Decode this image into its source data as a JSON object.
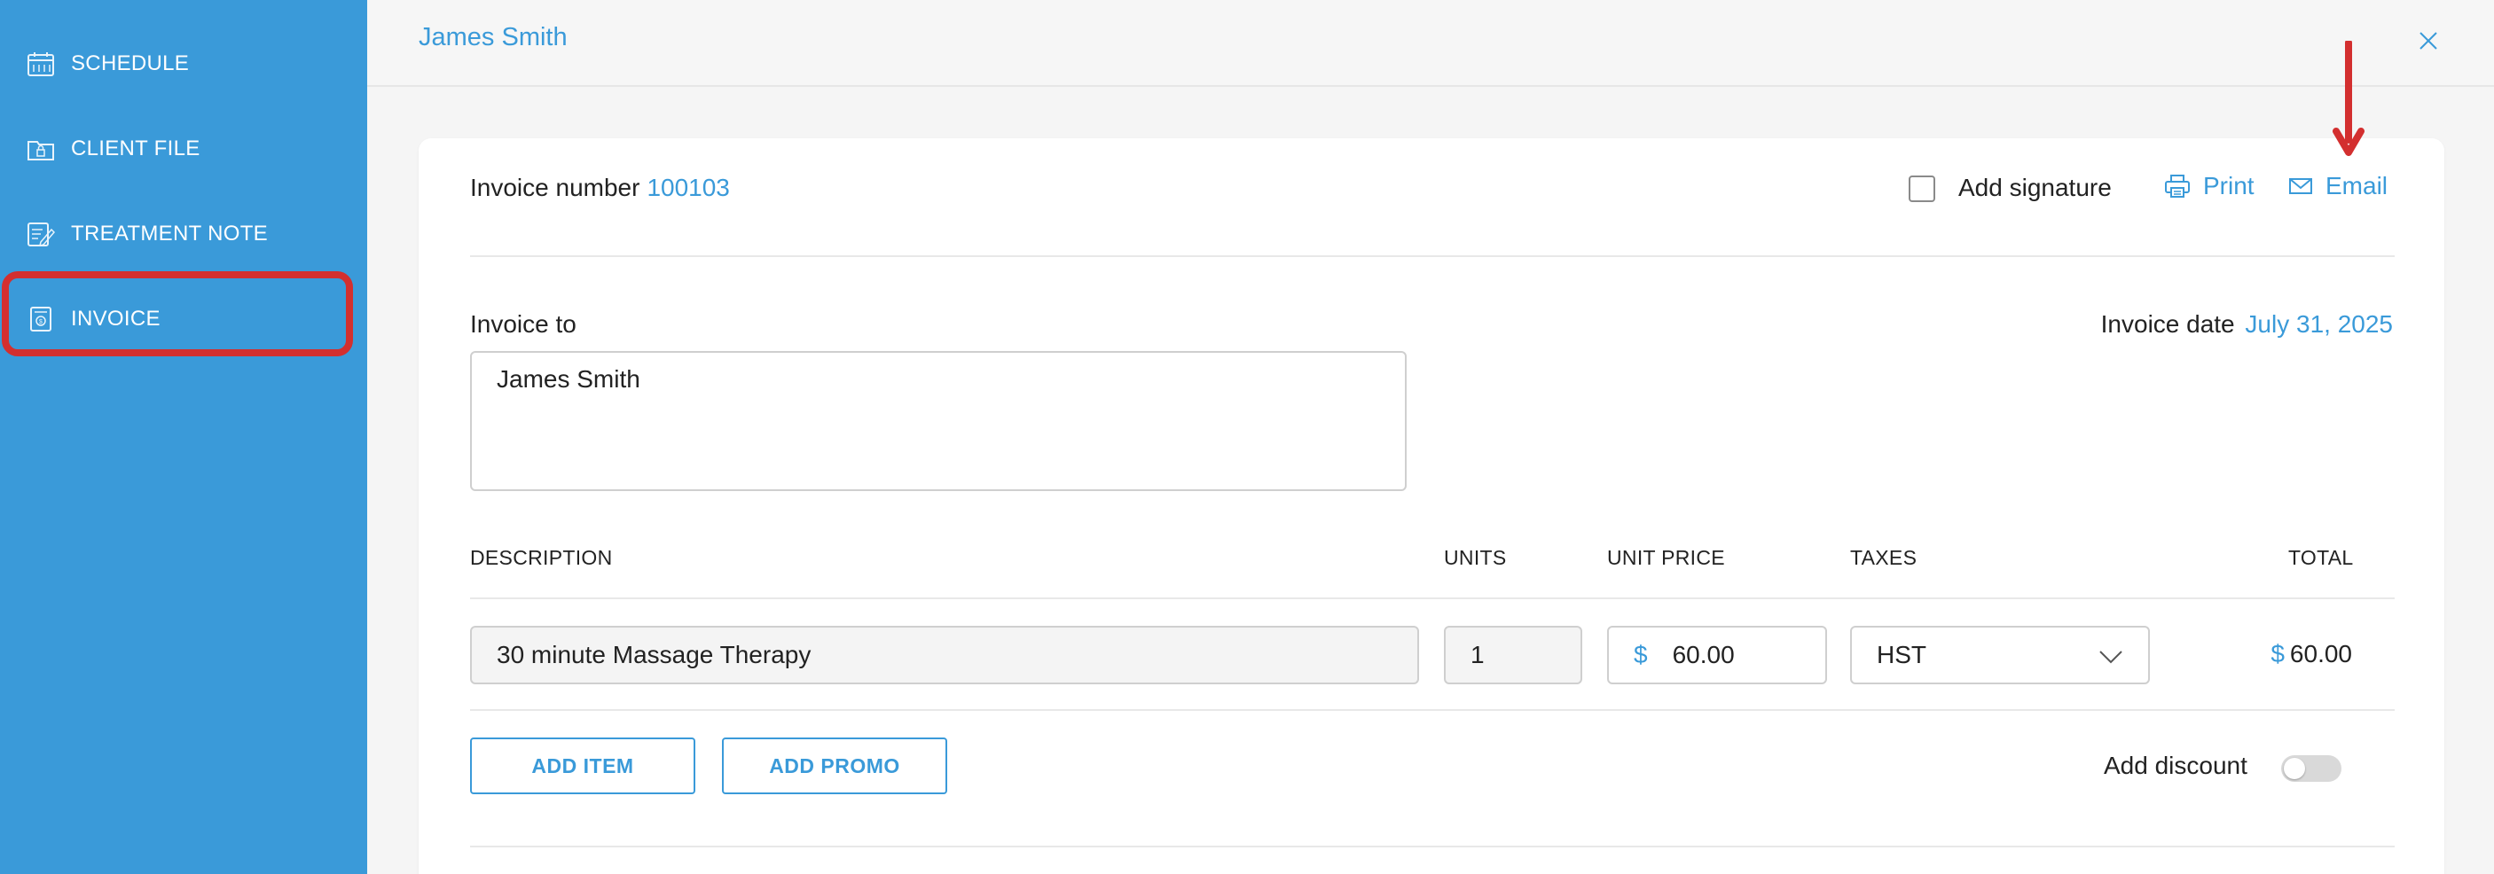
{
  "sidebar": {
    "items": [
      {
        "label": "SCHEDULE",
        "icon": "calendar-icon"
      },
      {
        "label": "CLIENT FILE",
        "icon": "folder-lock-icon"
      },
      {
        "label": "TREATMENT NOTE",
        "icon": "edit-note-icon"
      },
      {
        "label": "INVOICE",
        "icon": "invoice-icon",
        "active": true
      }
    ]
  },
  "header": {
    "title": "James Smith",
    "close_icon": "close-icon"
  },
  "invoice": {
    "number_label": "Invoice number",
    "number_value": "100103",
    "signature_label": "Add signature",
    "signature_checked": false,
    "print_label": "Print",
    "email_label": "Email",
    "to_label": "Invoice to",
    "to_value": "James Smith",
    "date_label": "Invoice date",
    "date_value": "July 31, 2025"
  },
  "table": {
    "headers": [
      "DESCRIPTION",
      "UNITS",
      "UNIT PRICE",
      "TAXES",
      "TOTAL"
    ],
    "rows": [
      {
        "description": "30 minute Massage Therapy",
        "units": "1",
        "currency": "$",
        "unit_price": "60.00",
        "tax": "HST",
        "total_currency": "$",
        "total": "60.00"
      }
    ]
  },
  "actions": {
    "add_item": "ADD ITEM",
    "add_promo": "ADD PROMO",
    "discount_label": "Add discount",
    "discount_enabled": false
  },
  "colors": {
    "accent": "#3a9ad9",
    "annotation": "#d32f2f"
  }
}
